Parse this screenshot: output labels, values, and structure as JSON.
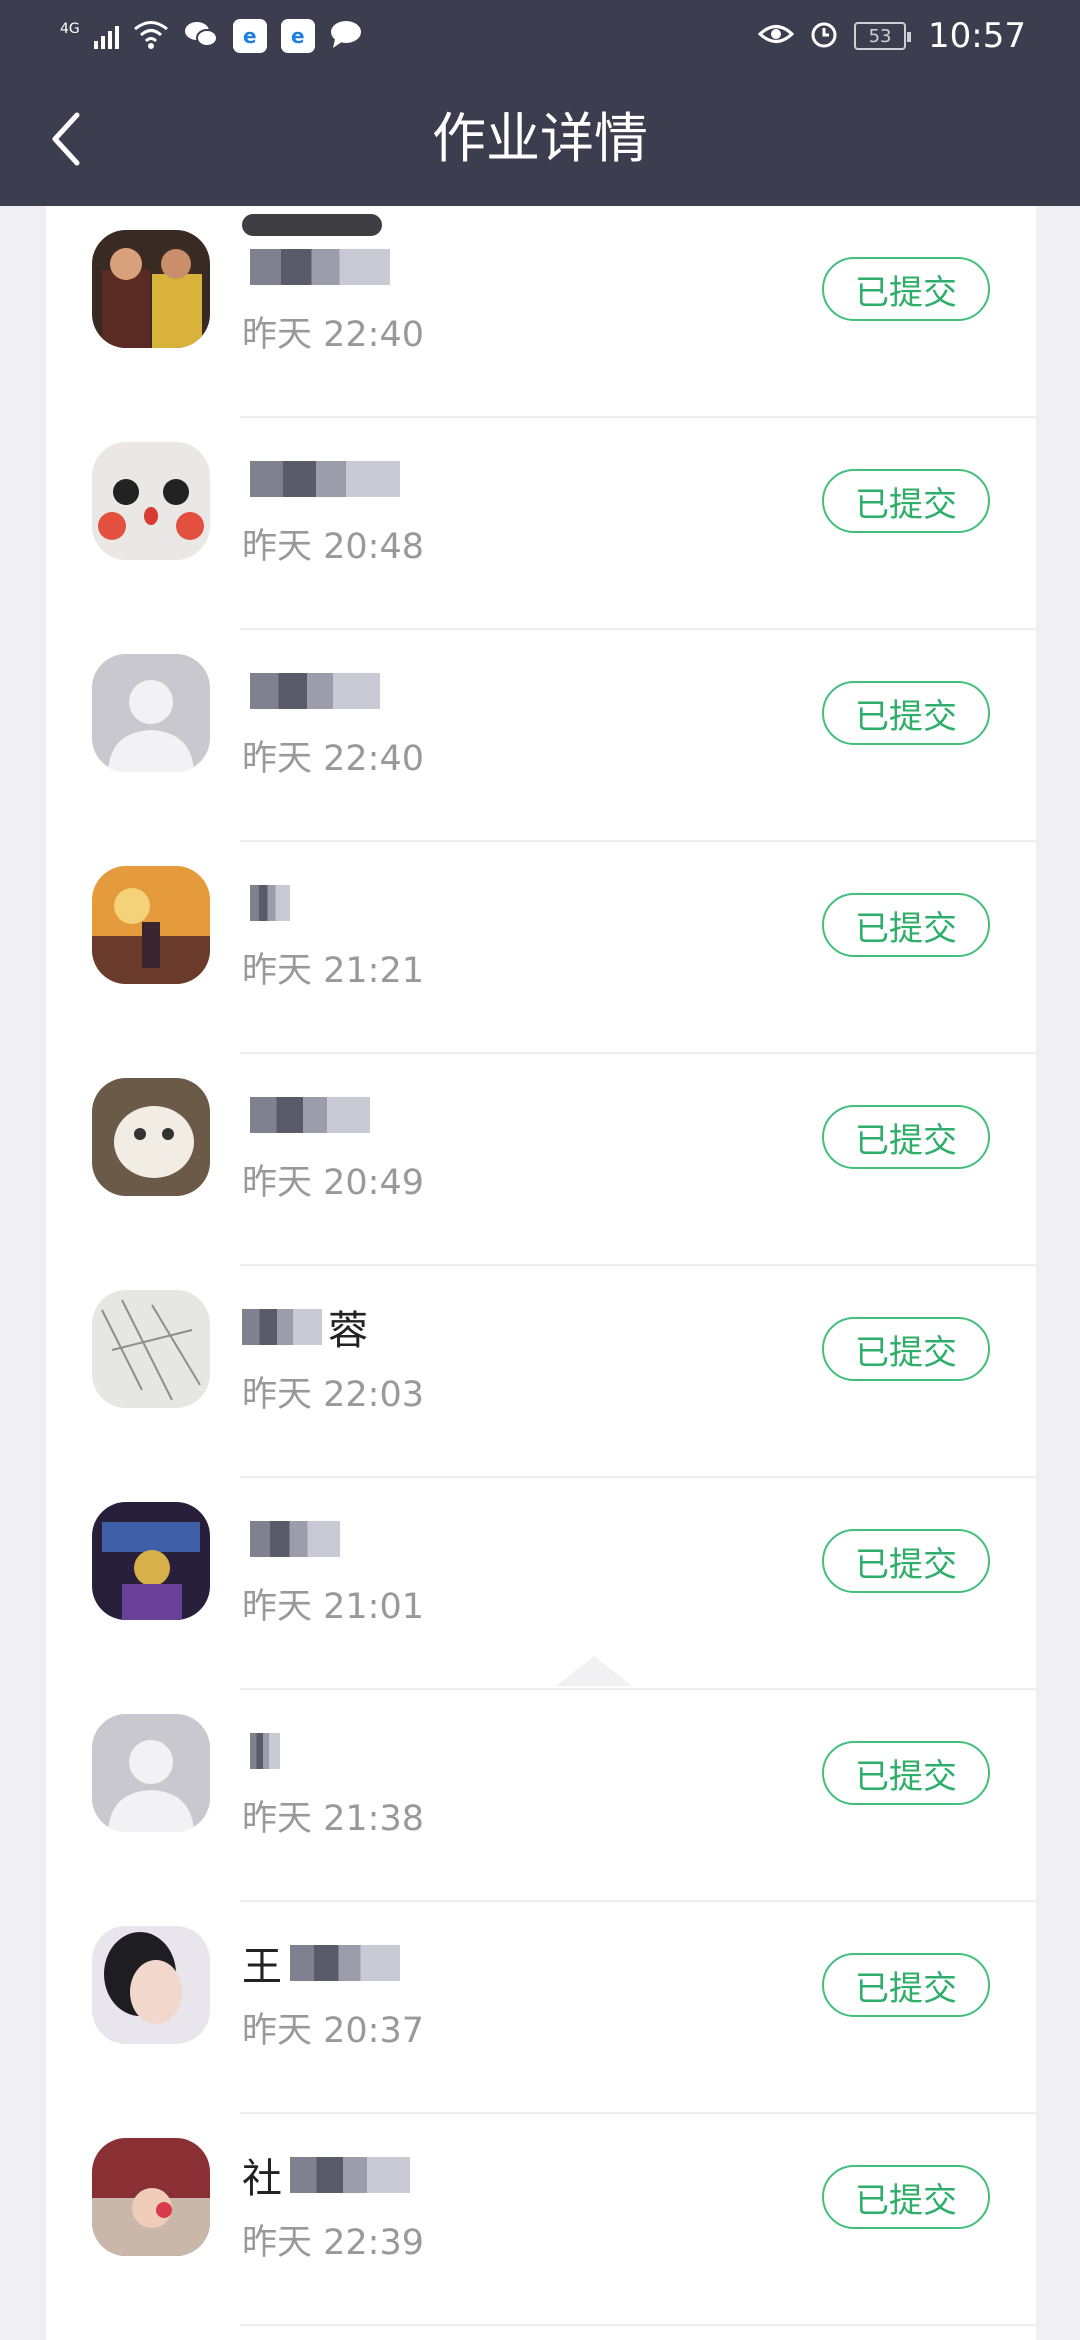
{
  "status_bar": {
    "network": "4G",
    "battery": "53",
    "time": "10:57",
    "icons": [
      "signal-icon",
      "wifi-icon",
      "wechat-icon",
      "app-icon",
      "app-icon",
      "message-icon",
      "eye-icon",
      "alarm-icon",
      "battery-icon"
    ]
  },
  "header": {
    "title": "作业详情",
    "back_icon": "chevron-left-icon"
  },
  "colors": {
    "header_bg": "#3c3e4f",
    "status_green": "#2fae6a",
    "page_bg": "#efeff4"
  },
  "submissions": [
    {
      "name": "",
      "time": "昨天 22:40",
      "status": "已提交",
      "avatar": "photo-avatar"
    },
    {
      "name": "",
      "time": "昨天 20:48",
      "status": "已提交",
      "avatar": "photo-avatar"
    },
    {
      "name": "",
      "time": "昨天 22:40",
      "status": "已提交",
      "avatar": "default-avatar"
    },
    {
      "name": "",
      "time": "昨天 21:21",
      "status": "已提交",
      "avatar": "photo-avatar"
    },
    {
      "name": "",
      "time": "昨天 20:49",
      "status": "已提交",
      "avatar": "photo-avatar"
    },
    {
      "name": "蓉",
      "time": "昨天 22:03",
      "status": "已提交",
      "avatar": "photo-avatar"
    },
    {
      "name": "",
      "time": "昨天 21:01",
      "status": "已提交",
      "avatar": "photo-avatar"
    },
    {
      "name": "",
      "time": "昨天 21:38",
      "status": "已提交",
      "avatar": "default-avatar"
    },
    {
      "name": "王",
      "time": "昨天 20:37",
      "status": "已提交",
      "avatar": "photo-avatar"
    },
    {
      "name": "社",
      "time": "昨天 22:39",
      "status": "已提交",
      "avatar": "photo-avatar"
    }
  ]
}
